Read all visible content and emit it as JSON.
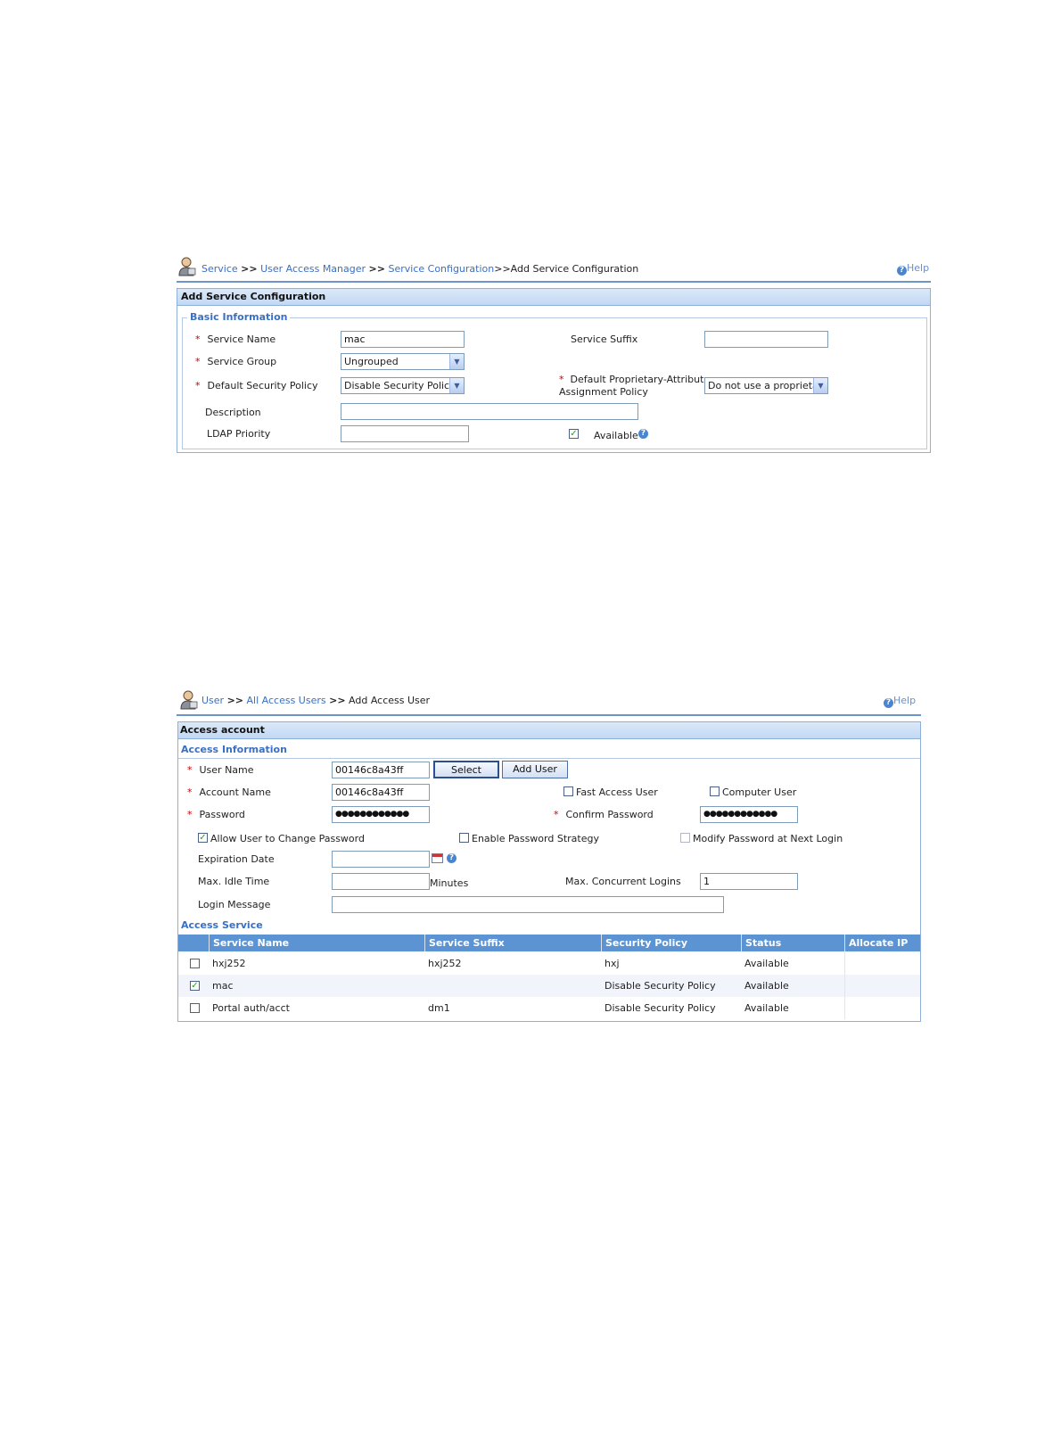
{
  "s1": {
    "breadcrumb": {
      "items": [
        "Service",
        "User Access Manager",
        "Service Configuration"
      ],
      "sep": ">>",
      "current": ">>Add Service Configuration"
    },
    "help": "Help",
    "title": "Add Service Configuration",
    "legend": "Basic Information",
    "service_name": {
      "label": "Service Name",
      "value": "mac"
    },
    "service_suffix": {
      "label": "Service Suffix",
      "value": ""
    },
    "service_group": {
      "label": "Service Group",
      "value": "Ungrouped"
    },
    "default_security_policy": {
      "label": "Default Security Policy",
      "value": "Disable Security Policy"
    },
    "proprietary": {
      "label_line1": "Default Proprietary-Attribute",
      "label_line2": "Assignment Policy",
      "value": "Do not use a proprietar"
    },
    "description": {
      "label": "Description",
      "value": ""
    },
    "ldap_priority": {
      "label": "LDAP Priority",
      "value": ""
    },
    "available": {
      "label": "Available",
      "checked": true
    }
  },
  "s2": {
    "breadcrumb": {
      "items": [
        "User",
        "All Access Users"
      ],
      "sep": ">>",
      "current": "Add Access User"
    },
    "help": "Help",
    "title": "Access account",
    "access_info": "Access Information",
    "user_name": {
      "label": "User Name",
      "value": "00146c8a43ff"
    },
    "select_btn": "Select",
    "add_user_btn": "Add User",
    "account_name": {
      "label": "Account Name",
      "value": "00146c8a43ff"
    },
    "fast_access": {
      "label": "Fast Access User",
      "checked": false
    },
    "computer_user": {
      "label": "Computer User",
      "checked": false
    },
    "password": {
      "label": "Password",
      "value": "●●●●●●●●●●●●"
    },
    "confirm_password": {
      "label": "Confirm Password",
      "value": "●●●●●●●●●●●●"
    },
    "allow_change": {
      "label": "Allow User to Change Password",
      "checked": true
    },
    "enable_strategy": {
      "label": "Enable Password Strategy",
      "checked": false
    },
    "modify_next": {
      "label": "Modify Password at Next Login",
      "checked": false
    },
    "expiration_date": {
      "label": "Expiration Date",
      "value": ""
    },
    "max_idle": {
      "label": "Max. Idle Time",
      "value": "",
      "unit": "Minutes"
    },
    "max_logins": {
      "label": "Max. Concurrent Logins",
      "value": "1"
    },
    "login_message": {
      "label": "Login Message",
      "value": ""
    },
    "access_service": "Access Service",
    "table": {
      "headers": [
        "Service Name",
        "Service Suffix",
        "Security Policy",
        "Status",
        "Allocate IP"
      ],
      "rows": [
        {
          "checked": false,
          "name": "hxj252",
          "suffix": "hxj252",
          "policy": "hxj",
          "status": "Available",
          "ip": ""
        },
        {
          "checked": true,
          "name": "mac",
          "suffix": "",
          "policy": "Disable Security Policy",
          "status": "Available",
          "ip": ""
        },
        {
          "checked": false,
          "name": "Portal auth/acct",
          "suffix": "dm1",
          "policy": "Disable Security Policy",
          "status": "Available",
          "ip": ""
        }
      ]
    }
  },
  "icons": {
    "person": "user-admin-icon",
    "help": "help-icon",
    "calendar": "calendar-icon",
    "dropdown": "chevron-down-icon"
  },
  "colors": {
    "link": "#3a6fc2",
    "header_bar": "#5b93d3",
    "required": "#cc0000"
  },
  "glyphs": {
    "req": "*",
    "help_q": "?",
    "check": "✓",
    "arrow": "▼"
  }
}
